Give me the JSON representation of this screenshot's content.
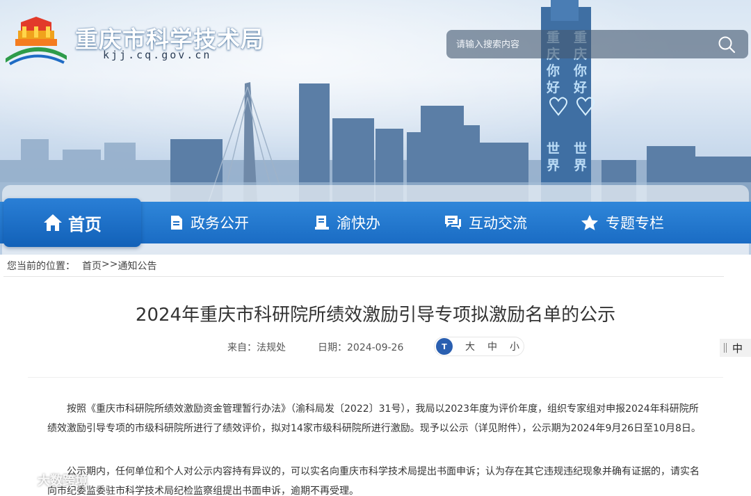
{
  "header": {
    "site_title": "重庆市科学技术局",
    "site_domain": "kjj.cq.gov.cn",
    "search_placeholder": "请输入搜索内容"
  },
  "nav": {
    "items": [
      {
        "label": "首页",
        "icon": "home-icon",
        "active": true
      },
      {
        "label": "政务公开",
        "icon": "document-icon"
      },
      {
        "label": "渝快办",
        "icon": "service-icon"
      },
      {
        "label": "互动交流",
        "icon": "chat-icon"
      },
      {
        "label": "专题专栏",
        "icon": "star-icon"
      }
    ]
  },
  "breadcrumb": {
    "prefix": "您当前的位置：",
    "home": "首页",
    "sep": ">>",
    "current": "通知公告"
  },
  "article": {
    "title": "2024年重庆市科研院所绩效激励引导专项拟激励名单的公示",
    "source_label": "来自：",
    "source": "法规处",
    "date_label": "日期：",
    "date": "2024-09-26",
    "font_size_icon_text": "T",
    "font_sizes": [
      "大",
      "中",
      "小"
    ],
    "paragraphs": [
      "按照《重庆市科研院所绩效激励资金管理暂行办法》（渝科局发〔2022〕31号），我局以2023年度为评价年度，组织专家组对申报2024年科研院所绩效激励引导专项的市级科研院所进行了绩效评价，拟对14家市级科研院所进行激励。现予以公示（详见附件），公示期为2024年9月26日至10月8日。",
      "公示期内，任何单位和个人对公示内容持有异议的，可以实名向重庆市科学技术局提出书面申诉；认为存在其它违规违纪现象并确有证据的，请实名向市纪委监委驻市科学技术局纪检监察组提出书面申诉，逾期不再受理。"
    ]
  },
  "lang_tab": {
    "label": "中"
  },
  "watermark": {
    "text": "大数跨境"
  },
  "colors": {
    "nav_blue": "#1a6cc4",
    "title_text": "#333333"
  }
}
